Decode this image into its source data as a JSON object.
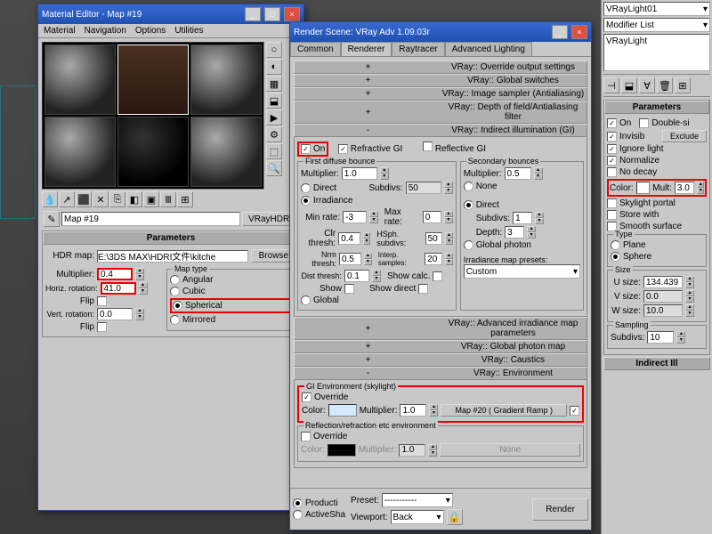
{
  "matEditor": {
    "title": "Material Editor - Map #19",
    "menu": [
      "Material",
      "Navigation",
      "Options",
      "Utilities"
    ],
    "mapName": "Map #19",
    "mapType": "VRayHDRI",
    "rollParams": "Parameters",
    "hdrLbl": "HDR map:",
    "hdrPath": "E:\\3DS MAX\\HDRI文件\\kitche",
    "browse": "Browse",
    "multLbl": "Multiplier:",
    "mult": "0.4",
    "hrotLbl": "Horiz. rotation:",
    "hrot": "41.0",
    "flip1": "Flip",
    "vrotLbl": "Vert. rotation:",
    "vrot": "0.0",
    "flip2": "Flip",
    "mapTypeLbl": "Map type",
    "angular": "Angular",
    "cubic": "Cubic",
    "spherical": "Spherical",
    "mirrored": "Mirrored"
  },
  "render": {
    "title": "Render Scene: VRay Adv 1.09.03r",
    "tabs": [
      "Common",
      "Renderer",
      "Raytracer",
      "Advanced Lighting"
    ],
    "r_override": "VRay:: Override output settings",
    "r_global": "VRay:: Global switches",
    "r_sampler": "VRay:: Image sampler (Antialiasing)",
    "r_dof": "VRay:: Depth of field/Antialiasing filter",
    "r_gi": "VRay:: Indirect illumination (GI)",
    "on": "On",
    "refractive": "Refractive GI",
    "reflective": "Reflective GI",
    "firstBounce": "First diffuse bounce",
    "multiplier": "Multiplier:",
    "fmult": "1.0",
    "direct": "Direct",
    "subdivs": "Subdivs:",
    "fsubdivs": "50",
    "irrad": "Irradiance",
    "minrate": "Min rate:",
    "minrateV": "-3",
    "maxrate": "Max rate:",
    "maxrateV": "0",
    "clrthresh": "Clr thresh:",
    "clrthreshV": "0.4",
    "hsph": "HSph. subdivs:",
    "hsphV": "50",
    "nrmthresh": "Nrm thresh:",
    "nrmthreshV": "0.5",
    "interp": "Interp. samples:",
    "interpV": "20",
    "distthresh": "Dist thresh:",
    "distthreshV": "0.1",
    "showcalc": "Show calc.",
    "show": "Show",
    "showdirect": "Show direct",
    "global": "Global",
    "secBounce": "Secondary bounces",
    "smult": "0.5",
    "none": "None",
    "sDirect": "Direct",
    "ssubdivs": "Subdivs:",
    "ssubdivsV": "1",
    "depth": "Depth:",
    "depthV": "3",
    "gphoton": "Global photon",
    "presets": "Irradiance map presets:",
    "preset": "Custom",
    "r_adv": "VRay:: Advanced irradiance map parameters",
    "r_gphoton": "VRay:: Global photon map",
    "r_caustics": "VRay:: Caustics",
    "r_env": "VRay:: Environment",
    "giEnv": "GI Environment (skylight)",
    "override2": "Override",
    "color": "Color:",
    "envmult": "1.0",
    "mapBtn": "Map #20   ( Gradient Ramp )",
    "reflEnv": "Reflection/refraction etc environment",
    "rmult": "1.0",
    "noneMap": "None",
    "producti": "Producti",
    "activesha": "ActiveSha",
    "presetLbl": "Preset:",
    "presetV": "-----------",
    "viewportLbl": "Viewport:",
    "viewport": "Back",
    "renderBtn": "Render"
  },
  "sidebar": {
    "name": "VRayLight01",
    "modList": "Modifier List",
    "stackItem": "VRayLight",
    "params": "Parameters",
    "on": "On",
    "doubleSide": "Double-si",
    "invisib": "Invisib",
    "exclude": "Exclude",
    "ignoreLight": "Ignore light",
    "normalize": "Normalize",
    "nodecay": "No decay",
    "colorLbl": "Color:",
    "multLbl": "Mult:",
    "mult": "3.0",
    "skylight": "Skylight portal",
    "storeWith": "Store with",
    "smooth": "Smooth surface",
    "type": "Type",
    "plane": "Plane",
    "sphere": "Sphere",
    "size": "Size",
    "usize": "U size:",
    "usizeV": "134.439",
    "vsize": "V size:",
    "vsizeV": "0.0",
    "wsize": "W size:",
    "wsizeV": "10.0",
    "sampling": "Sampling",
    "samplingSubdivs": "Subdivs:",
    "samplingSubdivsV": "10",
    "indirect": "Indirect Ill"
  }
}
